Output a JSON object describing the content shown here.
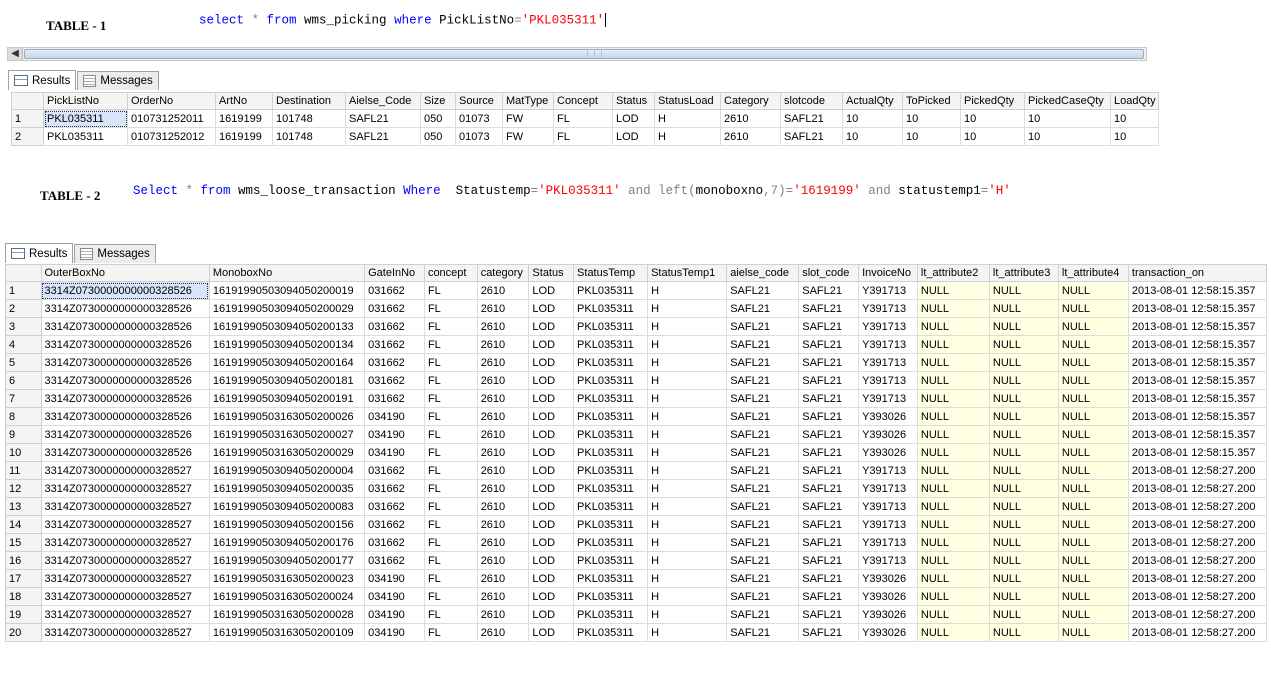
{
  "table1": {
    "label": "TABLE - 1",
    "sql": [
      {
        "t": "select",
        "c": "kw"
      },
      {
        "t": " * ",
        "c": "gr"
      },
      {
        "t": "from",
        "c": "kw"
      },
      {
        "t": " wms_picking ",
        "c": "plain"
      },
      {
        "t": "where",
        "c": "kw"
      },
      {
        "t": " PickListNo",
        "c": "plain"
      },
      {
        "t": "=",
        "c": "gr"
      },
      {
        "t": "'PKL035311'",
        "c": "str"
      }
    ],
    "tabs": [
      {
        "label": "Results",
        "icon": "grid-icon"
      },
      {
        "label": "Messages",
        "icon": "messages-icon"
      }
    ],
    "columns": [
      "PickListNo",
      "OrderNo",
      "ArtNo",
      "Destination",
      "Aielse_Code",
      "Size",
      "Source",
      "MatType",
      "Concept",
      "Status",
      "StatusLoad",
      "Category",
      "slotcode",
      "ActualQty",
      "ToPicked",
      "PickedQty",
      "PickedCaseQty",
      "LoadQty"
    ],
    "rows": [
      [
        "PKL035311",
        "010731252011",
        "1619199",
        "101748",
        "SAFL21",
        "050",
        "01073",
        "FW",
        "FL",
        "LOD",
        "H",
        "2610",
        "SAFL21",
        "10",
        "10",
        "10",
        "10",
        "10"
      ],
      [
        "PKL035311",
        "010731252012",
        "1619199",
        "101748",
        "SAFL21",
        "050",
        "01073",
        "FW",
        "FL",
        "LOD",
        "H",
        "2610",
        "SAFL21",
        "10",
        "10",
        "10",
        "10",
        "10"
      ]
    ]
  },
  "table2": {
    "label": "TABLE - 2",
    "sql": [
      {
        "t": "Select",
        "c": "kw"
      },
      {
        "t": " * ",
        "c": "gr"
      },
      {
        "t": "from",
        "c": "kw"
      },
      {
        "t": " wms_loose_transaction ",
        "c": "plain"
      },
      {
        "t": "Where",
        "c": "kw"
      },
      {
        "t": "  Statustemp",
        "c": "plain"
      },
      {
        "t": "=",
        "c": "gr"
      },
      {
        "t": "'PKL035311'",
        "c": "str"
      },
      {
        "t": " and left(",
        "c": "gr"
      },
      {
        "t": "monoboxno",
        "c": "plain"
      },
      {
        "t": ",7)=",
        "c": "gr"
      },
      {
        "t": "'1619199'",
        "c": "str"
      },
      {
        "t": " and ",
        "c": "gr"
      },
      {
        "t": "statustemp1",
        "c": "plain"
      },
      {
        "t": "=",
        "c": "gr"
      },
      {
        "t": "'H'",
        "c": "str"
      }
    ],
    "tabs": [
      {
        "label": "Results",
        "icon": "grid-icon"
      },
      {
        "label": "Messages",
        "icon": "messages-icon"
      }
    ],
    "columns": [
      "OuterBoxNo",
      "MonoboxNo",
      "GateInNo",
      "concept",
      "category",
      "Status",
      "StatusTemp",
      "StatusTemp1",
      "aielse_code",
      "slot_code",
      "InvoiceNo",
      "lt_attribute2",
      "lt_attribute3",
      "lt_attribute4",
      "transaction_on"
    ],
    "rows": [
      [
        "3314Z0730000000000328526",
        "16191990503094050200019",
        "031662",
        "FL",
        "2610",
        "LOD",
        "PKL035311",
        "H",
        "SAFL21",
        "SAFL21",
        "Y391713",
        "NULL",
        "NULL",
        "NULL",
        "2013-08-01 12:58:15.357"
      ],
      [
        "3314Z0730000000000328526",
        "16191990503094050200029",
        "031662",
        "FL",
        "2610",
        "LOD",
        "PKL035311",
        "H",
        "SAFL21",
        "SAFL21",
        "Y391713",
        "NULL",
        "NULL",
        "NULL",
        "2013-08-01 12:58:15.357"
      ],
      [
        "3314Z0730000000000328526",
        "16191990503094050200133",
        "031662",
        "FL",
        "2610",
        "LOD",
        "PKL035311",
        "H",
        "SAFL21",
        "SAFL21",
        "Y391713",
        "NULL",
        "NULL",
        "NULL",
        "2013-08-01 12:58:15.357"
      ],
      [
        "3314Z0730000000000328526",
        "16191990503094050200134",
        "031662",
        "FL",
        "2610",
        "LOD",
        "PKL035311",
        "H",
        "SAFL21",
        "SAFL21",
        "Y391713",
        "NULL",
        "NULL",
        "NULL",
        "2013-08-01 12:58:15.357"
      ],
      [
        "3314Z0730000000000328526",
        "16191990503094050200164",
        "031662",
        "FL",
        "2610",
        "LOD",
        "PKL035311",
        "H",
        "SAFL21",
        "SAFL21",
        "Y391713",
        "NULL",
        "NULL",
        "NULL",
        "2013-08-01 12:58:15.357"
      ],
      [
        "3314Z0730000000000328526",
        "16191990503094050200181",
        "031662",
        "FL",
        "2610",
        "LOD",
        "PKL035311",
        "H",
        "SAFL21",
        "SAFL21",
        "Y391713",
        "NULL",
        "NULL",
        "NULL",
        "2013-08-01 12:58:15.357"
      ],
      [
        "3314Z0730000000000328526",
        "16191990503094050200191",
        "031662",
        "FL",
        "2610",
        "LOD",
        "PKL035311",
        "H",
        "SAFL21",
        "SAFL21",
        "Y391713",
        "NULL",
        "NULL",
        "NULL",
        "2013-08-01 12:58:15.357"
      ],
      [
        "3314Z0730000000000328526",
        "16191990503163050200026",
        "034190",
        "FL",
        "2610",
        "LOD",
        "PKL035311",
        "H",
        "SAFL21",
        "SAFL21",
        "Y393026",
        "NULL",
        "NULL",
        "NULL",
        "2013-08-01 12:58:15.357"
      ],
      [
        "3314Z0730000000000328526",
        "16191990503163050200027",
        "034190",
        "FL",
        "2610",
        "LOD",
        "PKL035311",
        "H",
        "SAFL21",
        "SAFL21",
        "Y393026",
        "NULL",
        "NULL",
        "NULL",
        "2013-08-01 12:58:15.357"
      ],
      [
        "3314Z0730000000000328526",
        "16191990503163050200029",
        "034190",
        "FL",
        "2610",
        "LOD",
        "PKL035311",
        "H",
        "SAFL21",
        "SAFL21",
        "Y393026",
        "NULL",
        "NULL",
        "NULL",
        "2013-08-01 12:58:15.357"
      ],
      [
        "3314Z0730000000000328527",
        "16191990503094050200004",
        "031662",
        "FL",
        "2610",
        "LOD",
        "PKL035311",
        "H",
        "SAFL21",
        "SAFL21",
        "Y391713",
        "NULL",
        "NULL",
        "NULL",
        "2013-08-01 12:58:27.200"
      ],
      [
        "3314Z0730000000000328527",
        "16191990503094050200035",
        "031662",
        "FL",
        "2610",
        "LOD",
        "PKL035311",
        "H",
        "SAFL21",
        "SAFL21",
        "Y391713",
        "NULL",
        "NULL",
        "NULL",
        "2013-08-01 12:58:27.200"
      ],
      [
        "3314Z0730000000000328527",
        "16191990503094050200083",
        "031662",
        "FL",
        "2610",
        "LOD",
        "PKL035311",
        "H",
        "SAFL21",
        "SAFL21",
        "Y391713",
        "NULL",
        "NULL",
        "NULL",
        "2013-08-01 12:58:27.200"
      ],
      [
        "3314Z0730000000000328527",
        "16191990503094050200156",
        "031662",
        "FL",
        "2610",
        "LOD",
        "PKL035311",
        "H",
        "SAFL21",
        "SAFL21",
        "Y391713",
        "NULL",
        "NULL",
        "NULL",
        "2013-08-01 12:58:27.200"
      ],
      [
        "3314Z0730000000000328527",
        "16191990503094050200176",
        "031662",
        "FL",
        "2610",
        "LOD",
        "PKL035311",
        "H",
        "SAFL21",
        "SAFL21",
        "Y391713",
        "NULL",
        "NULL",
        "NULL",
        "2013-08-01 12:58:27.200"
      ],
      [
        "3314Z0730000000000328527",
        "16191990503094050200177",
        "031662",
        "FL",
        "2610",
        "LOD",
        "PKL035311",
        "H",
        "SAFL21",
        "SAFL21",
        "Y391713",
        "NULL",
        "NULL",
        "NULL",
        "2013-08-01 12:58:27.200"
      ],
      [
        "3314Z0730000000000328527",
        "16191990503163050200023",
        "034190",
        "FL",
        "2610",
        "LOD",
        "PKL035311",
        "H",
        "SAFL21",
        "SAFL21",
        "Y393026",
        "NULL",
        "NULL",
        "NULL",
        "2013-08-01 12:58:27.200"
      ],
      [
        "3314Z0730000000000328527",
        "16191990503163050200024",
        "034190",
        "FL",
        "2610",
        "LOD",
        "PKL035311",
        "H",
        "SAFL21",
        "SAFL21",
        "Y393026",
        "NULL",
        "NULL",
        "NULL",
        "2013-08-01 12:58:27.200"
      ],
      [
        "3314Z0730000000000328527",
        "16191990503163050200028",
        "034190",
        "FL",
        "2610",
        "LOD",
        "PKL035311",
        "H",
        "SAFL21",
        "SAFL21",
        "Y393026",
        "NULL",
        "NULL",
        "NULL",
        "2013-08-01 12:58:27.200"
      ],
      [
        "3314Z0730000000000328527",
        "16191990503163050200109",
        "034190",
        "FL",
        "2610",
        "LOD",
        "PKL035311",
        "H",
        "SAFL21",
        "SAFL21",
        "Y393026",
        "NULL",
        "NULL",
        "NULL",
        "2013-08-01 12:58:27.200"
      ]
    ]
  }
}
